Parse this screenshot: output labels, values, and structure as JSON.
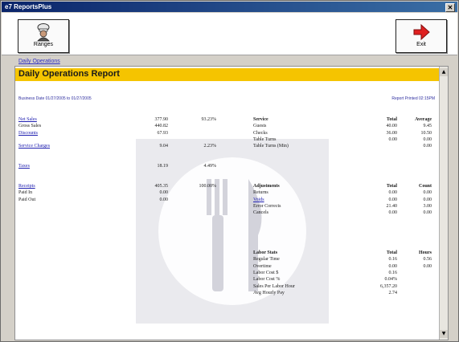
{
  "window": {
    "title": "e7 ReportsPlus"
  },
  "toolbar": {
    "ranges_label": "Ranges",
    "exit_label": "Exit"
  },
  "breadcrumb": "Daily Operations",
  "report": {
    "title": "Daily Operations Report",
    "business_date": "Business Date 01/27/2005 to 01/27/2005",
    "printed": "Report Printed 02:15PM"
  },
  "left": [
    {
      "label": "Net Sales",
      "value": "377.90",
      "pct": "93.23%",
      "link": true
    },
    {
      "label": "Gross Sales",
      "value": "440.82",
      "pct": "",
      "link": false
    },
    {
      "label": "Discounts",
      "value": "67.93",
      "pct": "",
      "link": true
    },
    {
      "label": "",
      "value": "",
      "pct": "",
      "link": false
    },
    {
      "label": "Service Charges",
      "value": "9.04",
      "pct": "2.23%",
      "link": true
    },
    {
      "label": "",
      "value": "",
      "pct": "",
      "link": false
    },
    {
      "label": "",
      "value": "",
      "pct": "",
      "link": false
    },
    {
      "label": "Taxes",
      "value": "18.19",
      "pct": "4.49%",
      "link": true
    },
    {
      "label": "",
      "value": "",
      "pct": "",
      "link": false
    },
    {
      "label": "",
      "value": "",
      "pct": "",
      "link": false
    },
    {
      "label": "Receipts",
      "value": "405.35",
      "pct": "100.00%",
      "link": true
    },
    {
      "label": "Paid In",
      "value": "0.00",
      "pct": "",
      "link": false
    },
    {
      "label": "Paid Out",
      "value": "0.00",
      "pct": "",
      "link": false
    }
  ],
  "service": {
    "header": [
      "Service",
      "Total",
      "Average"
    ],
    "rows": [
      [
        "Guests",
        "40.00",
        "9.45"
      ],
      [
        "Checks",
        "36.00",
        "10.50"
      ],
      [
        "Table Turns",
        "0.00",
        "0.00"
      ],
      [
        "Table Turns (Min)",
        "",
        "0.00"
      ]
    ]
  },
  "adjustments": {
    "header": [
      "Adjustments",
      "Total",
      "Count"
    ],
    "rows": [
      [
        "Returns",
        "0.00",
        "0.00"
      ],
      [
        "Voids",
        "0.00",
        "0.00"
      ],
      [
        "Error Corrects",
        "21.40",
        "3.00"
      ],
      [
        "Cancels",
        "0.00",
        "0.00"
      ]
    ]
  },
  "labor": {
    "header": [
      "Labor Stats",
      "Total",
      "Hours"
    ],
    "rows": [
      [
        "Regular Time",
        "0.16",
        "0.56"
      ],
      [
        "Overtime",
        "0.00",
        "0.00"
      ],
      [
        "Labor Cost $",
        "0.16",
        ""
      ],
      [
        "Labor Cost %",
        "0.04%",
        ""
      ],
      [
        "Sales Per Labor Hour",
        "6,357.20",
        ""
      ],
      [
        "Avg Hourly Pay",
        "2.74",
        ""
      ]
    ]
  },
  "colors": {
    "banner": "#f5c400",
    "link": "#2020b0",
    "exit_arrow": "#e02020"
  },
  "icons": {
    "ranges": "chef-icon",
    "exit": "exit-arrow-icon"
  }
}
